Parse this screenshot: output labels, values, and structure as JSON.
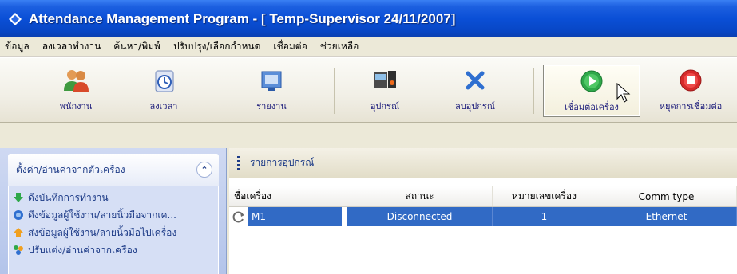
{
  "window": {
    "title": "Attendance Management Program - [ Temp-Supervisor 24/11/2007]"
  },
  "menu": [
    "ข้อมูล",
    "ลงเวลาทำงาน",
    "ค้นหา/พิมพ์",
    "ปรับปรุง/เลือกกำหนด",
    "เชื่อมต่อ",
    "ช่วยเหลือ"
  ],
  "toolbar": {
    "employees": "พนักงาน",
    "time": "ลงเวลา",
    "report": "รายงาน",
    "device": "อุปกรณ์",
    "delete_device": "ลบอุปกรณ์",
    "connect": "เชื่อมต่อเครื่อง",
    "disconnect": "หยุดการเชื่อมต่อ"
  },
  "left_panel": {
    "title": "ตั้งค่า/อ่านค่าจากตัวเครื่อง",
    "items": [
      "ดึงบันทึกการทำงาน",
      "ดึงข้อมูลผู้ใช้งาน/ลายนิ้วมือจากเค...",
      "ส่งข้อมูลผู้ใช้งาน/ลายนิ้วมือไปเครื่อง",
      "ปรับแต่ง/อ่านค่าจากเครื่อง"
    ]
  },
  "device_list": {
    "title": "รายการอุปกรณ์",
    "columns": [
      "ชื่อเครื่อง",
      "สถานะ",
      "หมายเลขเครื่อง",
      "Comm type"
    ],
    "rows": [
      {
        "name": "M1",
        "status": "Disconnected",
        "number": "1",
        "comm": "Ethernet"
      }
    ]
  },
  "colors": {
    "title_bar": "#0a4fd6",
    "selection": "#316ac5",
    "panel_text": "#1d3b87"
  }
}
